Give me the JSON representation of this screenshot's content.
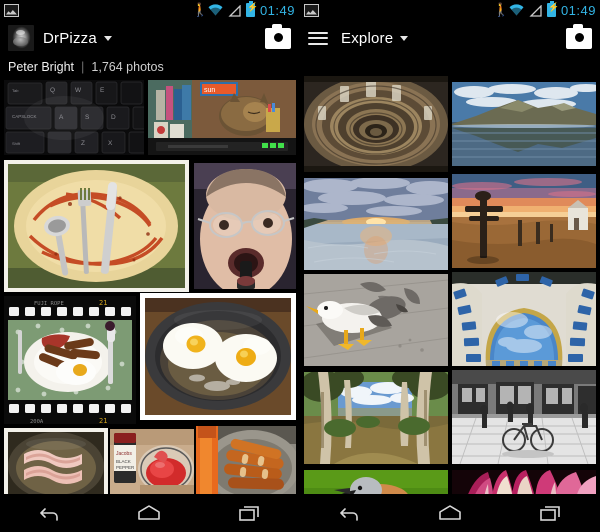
{
  "status_bar": {
    "notification_icon": "gallery-icon",
    "icons": [
      "runner-icon",
      "wifi-icon",
      "signal-icon",
      "battery-charging-icon"
    ],
    "clock": "01:49",
    "accent_color": "#33b5e5"
  },
  "left_screen": {
    "action_bar": {
      "avatar": "user-avatar",
      "title": "DrPizza",
      "dropdown_icon": "chevron-down-icon",
      "camera_icon": "camera-icon"
    },
    "sub_header": {
      "owner": "Peter Bright",
      "separator": "|",
      "photo_count": "1,764 photos"
    },
    "photos": [
      {
        "name": "photo-keyboard",
        "alt": "Backlit black keyboard keys"
      },
      {
        "name": "photo-cat-on-tv",
        "alt": "Tabby cat sleeping on top of a TV set"
      },
      {
        "name": "photo-empty-plate",
        "alt": "Empty plate with sauce smears, fork and knife"
      },
      {
        "name": "photo-man-eating",
        "alt": "Man with glasses eating from a fork"
      },
      {
        "name": "photo-fry-up-film",
        "alt": "Full English breakfast on a plate, film-strip frame"
      },
      {
        "name": "photo-fried-eggs-pan",
        "alt": "Two fried eggs in a frying pan"
      },
      {
        "name": "photo-bacon-pan",
        "alt": "Bacon rashers frying in a pan"
      },
      {
        "name": "photo-ketchup-bowl",
        "alt": "Ketchup in a glass bowl beside a sauce jar"
      },
      {
        "name": "photo-sausages-pan",
        "alt": "Browned sausages in a frying pan"
      }
    ],
    "nav_bar": {
      "back": "back-icon",
      "home": "home-icon",
      "recents": "recents-icon"
    }
  },
  "right_screen": {
    "action_bar": {
      "menu_icon": "hamburger-menu-icon",
      "title": "Explore",
      "dropdown_icon": "chevron-down-icon",
      "camera_icon": "camera-icon"
    },
    "photos": [
      {
        "name": "photo-spiral-staircase",
        "alt": "Looking down a circular spiral staircase"
      },
      {
        "name": "photo-mountain-reflection",
        "alt": "Mountain range reflected in a still lake"
      },
      {
        "name": "photo-beach-sunset",
        "alt": "Long-exposure beach at sunset with clouds"
      },
      {
        "name": "photo-signpost-sunset",
        "alt": "Wooden signpost on a beach at sunset"
      },
      {
        "name": "photo-seagull",
        "alt": "Seagull fighting a pigeon on pavement"
      },
      {
        "name": "photo-blue-atrium",
        "alt": "Blue tiled atrium ceiling looking up"
      },
      {
        "name": "photo-gum-trees",
        "alt": "Dirt track through eucalyptus gum trees"
      },
      {
        "name": "photo-bw-street",
        "alt": "Black and white street scene with a bicycle"
      },
      {
        "name": "photo-bird-green",
        "alt": "Shrike bird against a green background"
      },
      {
        "name": "photo-pink-flower",
        "alt": "Macro of a pink and white flower"
      }
    ],
    "nav_bar": {
      "back": "back-icon",
      "home": "home-icon",
      "recents": "recents-icon"
    }
  }
}
